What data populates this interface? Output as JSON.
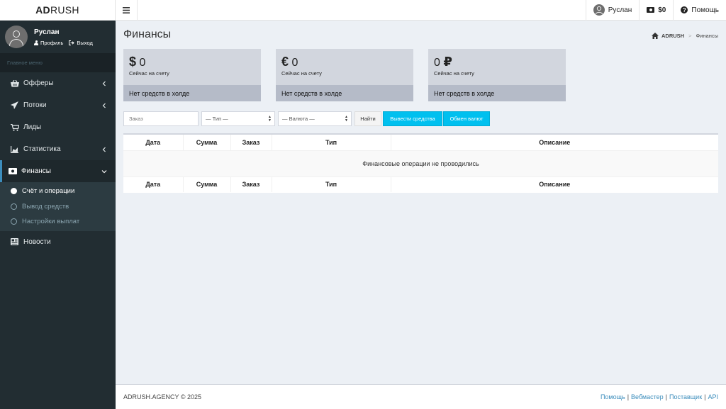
{
  "brand": {
    "bold": "AD",
    "rest": "RUSH"
  },
  "topbar": {
    "user_name": "Руслан",
    "balance": "$0",
    "help": "Помощь"
  },
  "sidebar": {
    "user_name": "Руслан",
    "profile_link": "Профиль",
    "logout_link": "Выход",
    "header": "Главное меню",
    "items": [
      {
        "label": "Офферы",
        "icon": "basket-icon",
        "has_chevron": true
      },
      {
        "label": "Потоки",
        "icon": "paper-plane-icon",
        "has_chevron": true
      },
      {
        "label": "Лиды",
        "icon": "cart-icon",
        "has_chevron": false
      },
      {
        "label": "Статистика",
        "icon": "area-chart-icon",
        "has_chevron": true
      },
      {
        "label": "Финансы",
        "icon": "money-icon",
        "has_chevron": true,
        "active": true
      },
      {
        "label": "Новости",
        "icon": "newspaper-icon",
        "has_chevron": false
      }
    ],
    "submenu": [
      {
        "label": "Счёт и операции",
        "active": true
      },
      {
        "label": "Вывод средств",
        "active": false
      },
      {
        "label": "Настройки выплат",
        "active": false
      }
    ]
  },
  "page": {
    "title": "Финансы",
    "breadcrumb": {
      "home": "ADRUSH",
      "current": "Финансы"
    }
  },
  "cards": [
    {
      "symbol": "$",
      "amount": "0",
      "subtitle": "Сейчас на счету",
      "hold": "Нет средств в холде"
    },
    {
      "symbol": "€",
      "amount": "0",
      "subtitle": "Сейчас на счету",
      "hold": "Нет средств в холде"
    },
    {
      "symbol": "₽",
      "amount": "0",
      "subtitle": "Сейчас на счету",
      "hold": "Нет средств в холде"
    }
  ],
  "filters": {
    "order_placeholder": "Заказ",
    "type_select": "— Тип —",
    "currency_select": "— Валюта —",
    "find_button": "Найти",
    "withdraw_button": "Вывести средства",
    "exchange_button": "Обмен валют"
  },
  "table": {
    "columns": [
      "Дата",
      "Сумма",
      "Заказ",
      "Тип",
      "Описание"
    ],
    "empty_message": "Финансовые операции не проводились"
  },
  "footer": {
    "copyright": "ADRUSH.AGENCY © 2025",
    "links": [
      "Помощь",
      "Вебмастер",
      "Поставщик",
      "API"
    ],
    "separator": "|"
  },
  "colors": {
    "sidebar_bg": "#222d32",
    "accent_blue": "#3c8dbc",
    "info_button": "#00c0ef",
    "card_bg": "#d2d6de",
    "card_footer_bg": "#b5bbc8"
  }
}
